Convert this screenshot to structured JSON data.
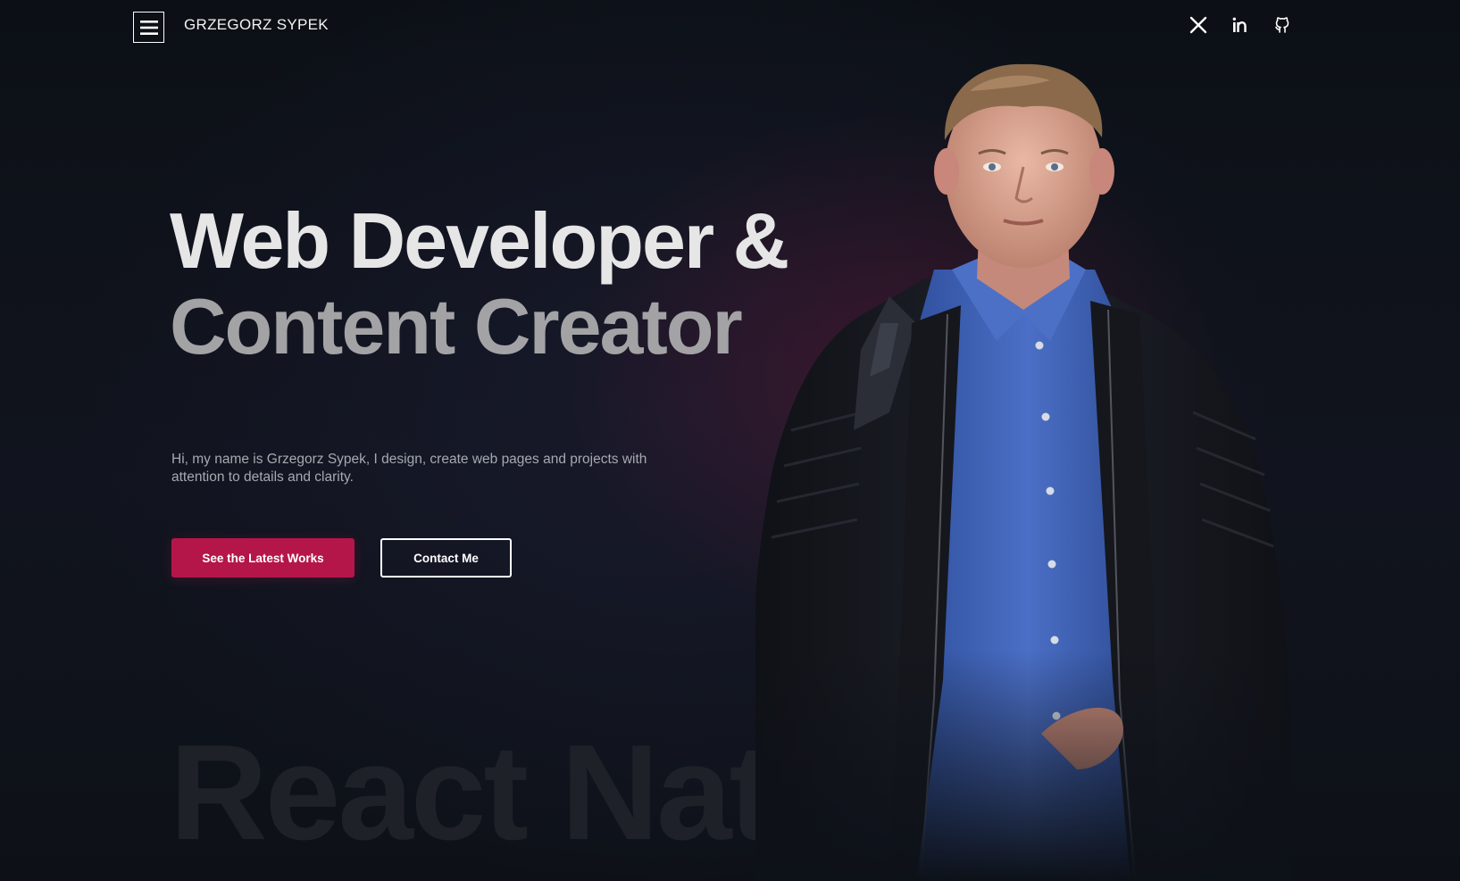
{
  "header": {
    "brand": "GRZEGORZ SYPEK",
    "menu_icon": "hamburger-menu-icon",
    "social": [
      {
        "name": "x-twitter",
        "icon": "x-icon"
      },
      {
        "name": "linkedin",
        "icon": "linkedin-icon"
      },
      {
        "name": "github",
        "icon": "github-icon"
      }
    ]
  },
  "hero": {
    "title_line1": "Web Developer &",
    "title_line2": "Content Creator",
    "intro": "Hi, my name is Grzegorz Sypek, I design, create web pages and projects with attention to details and clarity.",
    "primary_button": "See the Latest Works",
    "secondary_button": "Contact Me",
    "watermark": "React Native"
  },
  "colors": {
    "background": "#0d1118",
    "accent": "#b5164a",
    "title_primary": "#e6e6e6",
    "title_secondary": "#a3a3a6",
    "shirt": "#3e62b8",
    "jacket": "#16181e"
  }
}
